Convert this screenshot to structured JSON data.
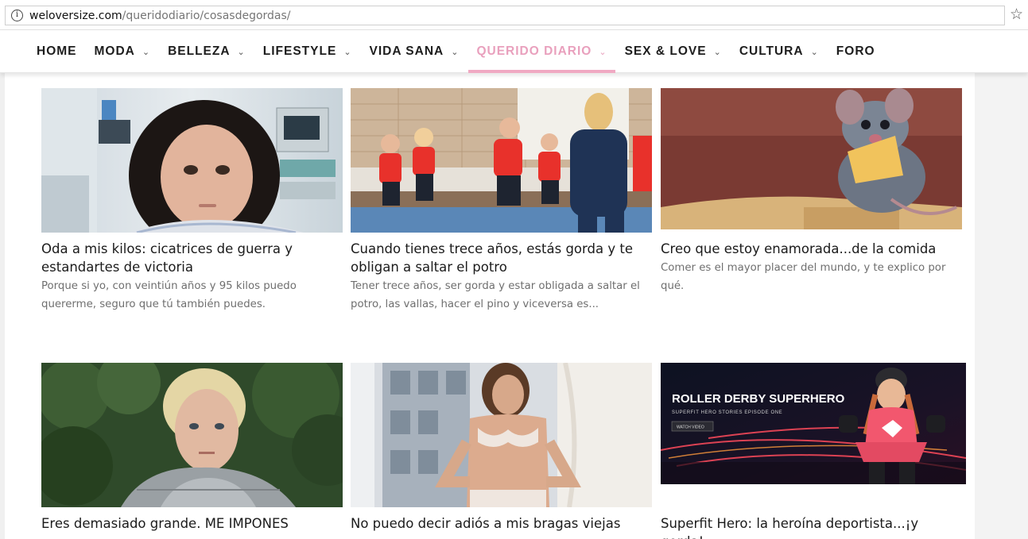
{
  "browser": {
    "url_domain": "weloversize.com",
    "url_path": "/queridodiario/cosasdegordas/",
    "info_icon": "i",
    "star_icon": "☆"
  },
  "nav": {
    "items": [
      {
        "label": "HOME",
        "has_dropdown": false,
        "active": false
      },
      {
        "label": "MODA",
        "has_dropdown": true,
        "active": false
      },
      {
        "label": "BELLEZA",
        "has_dropdown": true,
        "active": false
      },
      {
        "label": "LIFESTYLE",
        "has_dropdown": true,
        "active": false
      },
      {
        "label": "VIDA SANA",
        "has_dropdown": true,
        "active": false
      },
      {
        "label": "QUERIDO DIARIO",
        "has_dropdown": true,
        "active": true
      },
      {
        "label": "SEX & LOVE",
        "has_dropdown": true,
        "active": false
      },
      {
        "label": "CULTURA",
        "has_dropdown": true,
        "active": false
      },
      {
        "label": "FORO",
        "has_dropdown": false,
        "active": false
      }
    ],
    "chevron": "⌄",
    "accent_color": "#f0a9c3"
  },
  "articles": [
    {
      "title": "Oda a mis kilos: cicatrices de guerra y estandartes de victoria",
      "excerpt": "Porque si yo, con veintiún años y 95 kilos puedo quererme, seguro que tú también puedes."
    },
    {
      "title": "Cuando tienes trece años, estás gorda y te obligan a saltar el potro",
      "excerpt": "Tener trece años, ser gorda y estar obligada a saltar el potro, las vallas, hacer el pino y viceversa es..."
    },
    {
      "title": "Creo que estoy enamorada...de la comida",
      "excerpt": "Comer es el mayor placer del mundo, y te explico por qué."
    },
    {
      "title": "Eres demasiado grande. ME IMPONES",
      "excerpt": ""
    },
    {
      "title": "No puedo decir adiós a mis bragas viejas",
      "excerpt": ""
    },
    {
      "title": "Superfit Hero: la heroína deportista...¡y gorda!",
      "excerpt": ""
    }
  ],
  "superfit_banner": {
    "headline": "ROLLER DERBY SUPERHERO",
    "subline": "SUPERFIT HERO STORIES EPISODE ONE",
    "button": "WATCH VIDEO"
  }
}
